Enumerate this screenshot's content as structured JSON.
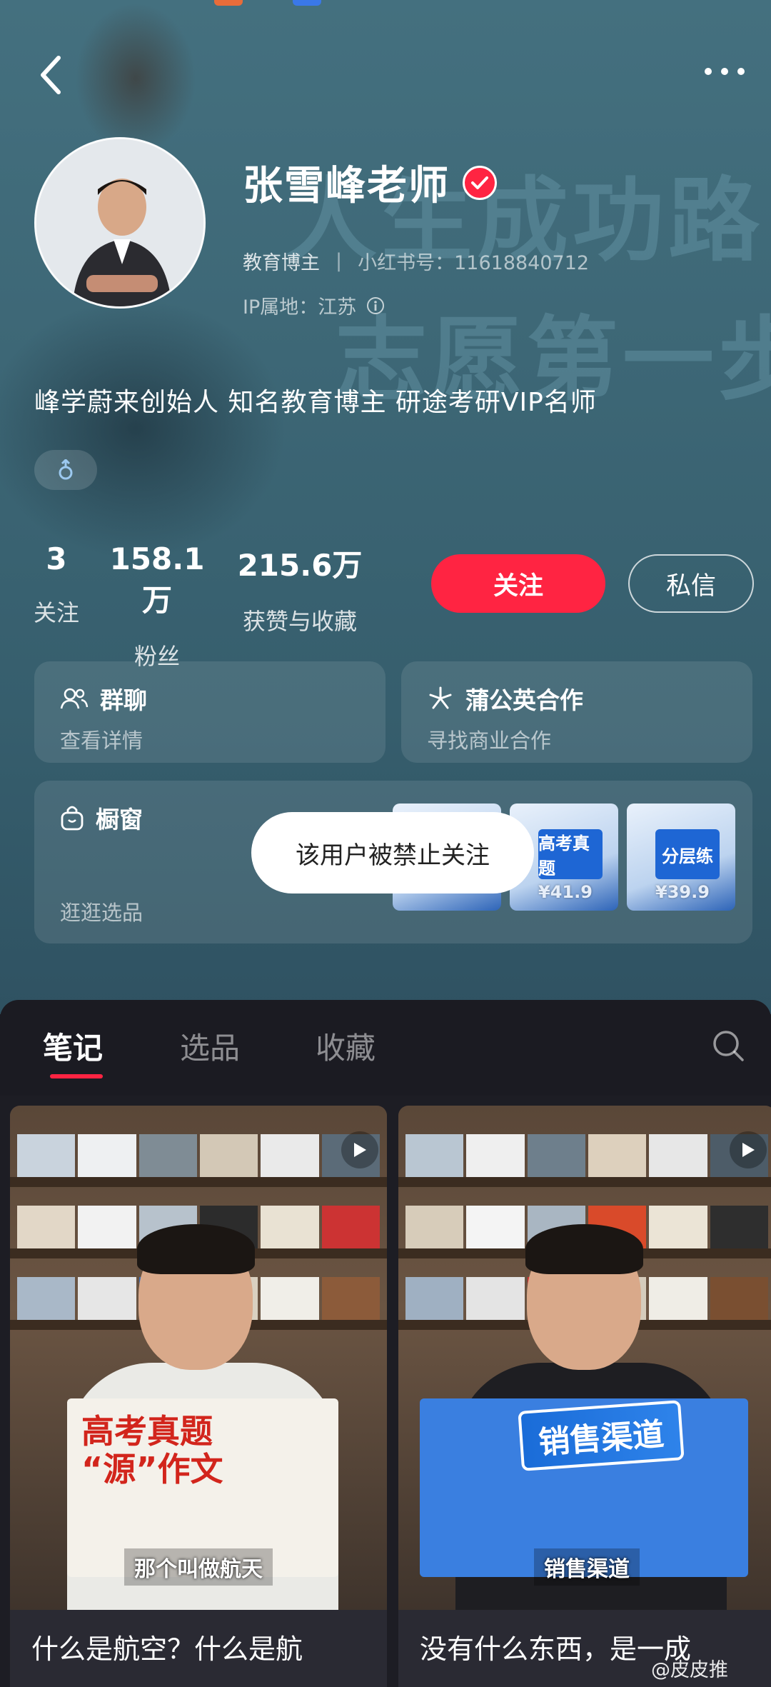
{
  "profile": {
    "name": "张雪峰老师",
    "role": "教育博主",
    "id_label": "小红书号：11618840712",
    "ip_label": "IP属地：江苏",
    "bio": "峰学蔚来创始人 知名教育博主 研途考研VIP名师",
    "banner_line_1": "人生成功路",
    "banner_line_2": "志愿第一步"
  },
  "stats": {
    "following_num": "3",
    "following_label": "关注",
    "fans_num": "158.1万",
    "fans_label": "粉丝",
    "likes_num": "215.6万",
    "likes_label": "获赞与收藏"
  },
  "actions": {
    "follow": "关注",
    "message": "私信"
  },
  "cards": {
    "group_title": "群聊",
    "group_sub": "查看详情",
    "biz_title": "蒲公英合作",
    "biz_sub": "寻找商业合作",
    "shop_title": "橱窗",
    "shop_sub": "逛逛选品"
  },
  "products": [
    {
      "price": "",
      "cover": ""
    },
    {
      "price": "¥41.9",
      "cover": "高考真题"
    },
    {
      "price": "¥39.9",
      "cover": "分层练"
    }
  ],
  "toast": "该用户被禁止关注",
  "tabs": {
    "notes": "笔记",
    "picks": "选品",
    "collect": "收藏"
  },
  "feed": [
    {
      "title": "什么是航空？什么是航",
      "book_line_1": "高考真题",
      "book_line_2": "“源”作文",
      "caption": "那个叫做航天"
    },
    {
      "title": "没有什么东西，是一成",
      "banner": "销售渠道",
      "caption": "销售渠道"
    }
  ],
  "watermark": "@皮皮推",
  "colors": {
    "accent": "#ff2442",
    "hero_bg": "#3d6776",
    "dark_bg": "#1d1d24"
  },
  "icons": [
    "chevron-left-icon",
    "more-dots-icon",
    "verified-icon",
    "info-icon",
    "male-icon",
    "group-icon",
    "pinwheel-icon",
    "bag-icon",
    "search-icon",
    "play-icon"
  ]
}
